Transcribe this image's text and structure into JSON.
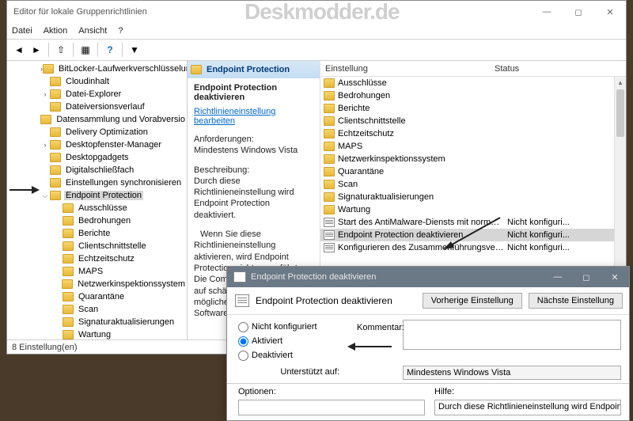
{
  "watermark": "Deskmodder.de",
  "window": {
    "title": "Editor für lokale Gruppenrichtlinien"
  },
  "menu": {
    "datei": "Datei",
    "aktion": "Aktion",
    "ansicht": "Ansicht",
    "help": "?"
  },
  "tree": [
    {
      "label": "BitLocker-Laufwerkverschlüsselun",
      "depth": 0,
      "chev": ">"
    },
    {
      "label": "Cloudinhalt",
      "depth": 0
    },
    {
      "label": "Datei-Explorer",
      "depth": 0,
      "chev": ">"
    },
    {
      "label": "Dateiversionsverlauf",
      "depth": 0
    },
    {
      "label": "Datensammlung und Vorabversio",
      "depth": 0
    },
    {
      "label": "Delivery Optimization",
      "depth": 0
    },
    {
      "label": "Desktopfenster-Manager",
      "depth": 0,
      "chev": ">"
    },
    {
      "label": "Desktopgadgets",
      "depth": 0
    },
    {
      "label": "Digitalschließfach",
      "depth": 0
    },
    {
      "label": "Einstellungen synchronisieren",
      "depth": 0
    },
    {
      "label": "Endpoint Protection",
      "depth": 0,
      "chev": "v",
      "selected": true
    },
    {
      "label": "Ausschlüsse",
      "depth": 1
    },
    {
      "label": "Bedrohungen",
      "depth": 1
    },
    {
      "label": "Berichte",
      "depth": 1
    },
    {
      "label": "Clientschnittstelle",
      "depth": 1
    },
    {
      "label": "Echtzeitschutz",
      "depth": 1
    },
    {
      "label": "MAPS",
      "depth": 1
    },
    {
      "label": "Netzwerkinspektionssystem",
      "depth": 1
    },
    {
      "label": "Quarantäne",
      "depth": 1
    },
    {
      "label": "Scan",
      "depth": 1
    },
    {
      "label": "Signaturaktualisierungen",
      "depth": 1
    },
    {
      "label": "Wartung",
      "depth": 1
    }
  ],
  "rightHeader": "Endpoint Protection",
  "desc": {
    "title": "Endpoint Protection deaktivieren",
    "link": "Richtlinieneinstellung bearbeiten",
    "req_label": "Anforderungen:",
    "req_text": "Mindestens Windows Vista",
    "desc_label": "Beschreibung:",
    "desc_text": "Durch diese Richtlinieneinstellung wird Endpoint Protection deaktiviert.",
    "p2": "Wenn Sie diese Richtlinieneinstellung aktivieren, wird Endpoint Protection nicht ausgeführt. Die Computer werden nicht auf schädliche oder andere möglicherweise unerwünschte Software überprüft."
  },
  "list": {
    "col_setting": "Einstellung",
    "col_status": "Status",
    "rows": [
      {
        "type": "folder",
        "name": "Ausschlüsse"
      },
      {
        "type": "folder",
        "name": "Bedrohungen"
      },
      {
        "type": "folder",
        "name": "Berichte"
      },
      {
        "type": "folder",
        "name": "Clientschnittstelle"
      },
      {
        "type": "folder",
        "name": "Echtzeitschutz"
      },
      {
        "type": "folder",
        "name": "MAPS"
      },
      {
        "type": "folder",
        "name": "Netzwerkinspektionssystem"
      },
      {
        "type": "folder",
        "name": "Quarantäne"
      },
      {
        "type": "folder",
        "name": "Scan"
      },
      {
        "type": "folder",
        "name": "Signaturaktualisierungen"
      },
      {
        "type": "folder",
        "name": "Wartung"
      },
      {
        "type": "doc",
        "name": "Start des AntiMalware-Diensts mit normaler Priorität gestatt...",
        "status": "Nicht konfiguri..."
      },
      {
        "type": "doc",
        "name": "Endpoint Protection deaktivieren",
        "status": "Nicht konfiguri...",
        "selected": true
      },
      {
        "type": "doc",
        "name": "Konfigurieren des Zusammenführungsverhaltens von lokale...",
        "status": "Nicht konfiguri..."
      }
    ]
  },
  "statusbar": "8 Einstellung(en)",
  "dialog": {
    "title": "Endpoint Protection deaktivieren",
    "head_title": "Endpoint Protection deaktivieren",
    "prev_btn": "Vorherige Einstellung",
    "next_btn": "Nächste Einstellung",
    "opt_not": "Nicht konfiguriert",
    "opt_on": "Aktiviert",
    "opt_off": "Deaktiviert",
    "kommentar": "Kommentar:",
    "supported_label": "Unterstützt auf:",
    "supported_text": "Mindestens Windows Vista",
    "options": "Optionen:",
    "help": "Hilfe:",
    "help_text": "Durch diese Richtlinieneinstellung wird Endpoint Protection"
  }
}
